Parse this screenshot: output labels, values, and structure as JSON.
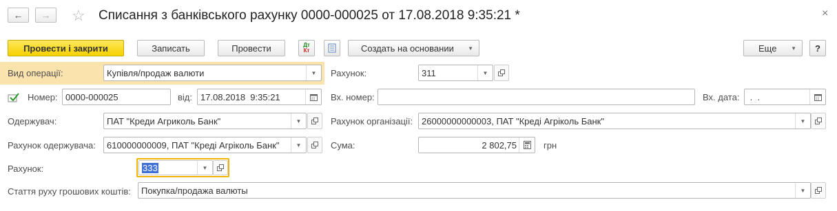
{
  "header": {
    "title": "Списання з банківського рахунку 0000-000025 от 17.08.2018 9:35:21 *",
    "close_glyph": "×"
  },
  "toolbar": {
    "post_close_label": "Провести і закрити",
    "save_label": "Записать",
    "post_label": "Провести",
    "dtkt_label": "Дт Кт",
    "create_based_label": "Создать на основании",
    "more_label": "Еще",
    "help_label": "?"
  },
  "form": {
    "operation_type": {
      "label": "Вид операції:",
      "value": "Купівля/продаж валюти"
    },
    "account_top": {
      "label": "Рахунок:",
      "value": "311"
    },
    "number": {
      "label": "Номер:",
      "value": "0000-000025"
    },
    "date": {
      "label": "від:",
      "value": "17.08.2018  9:35:21"
    },
    "incoming_number": {
      "label": "Вх. номер:",
      "value": ""
    },
    "incoming_date": {
      "label": "Вх. дата:",
      "value": " .  ."
    },
    "recipient": {
      "label": "Одержувач:",
      "value": "ПАТ \"Креди Агриколь Банк\""
    },
    "org_account": {
      "label": "Рахунок організації:",
      "value": "26000000000003, ПАТ \"Креді Агріколь Банк\""
    },
    "recipient_account": {
      "label": "Рахунок одержувача:",
      "value": "610000000009, ПАТ \"Креді Агріколь Банк\""
    },
    "amount": {
      "label": "Сума:",
      "value": "2 802,75",
      "currency": "грн"
    },
    "account_bottom": {
      "label": "Рахунок:",
      "value": "333"
    },
    "cash_flow_item": {
      "label": "Стаття руху грошових коштів:",
      "value": "Покупка/продажа валюты"
    }
  },
  "colors": {
    "primary_button": "#f5d000",
    "highlight_row": "#fbe3ad",
    "focus_border": "#f0b400",
    "selection": "#3d6fd4"
  }
}
